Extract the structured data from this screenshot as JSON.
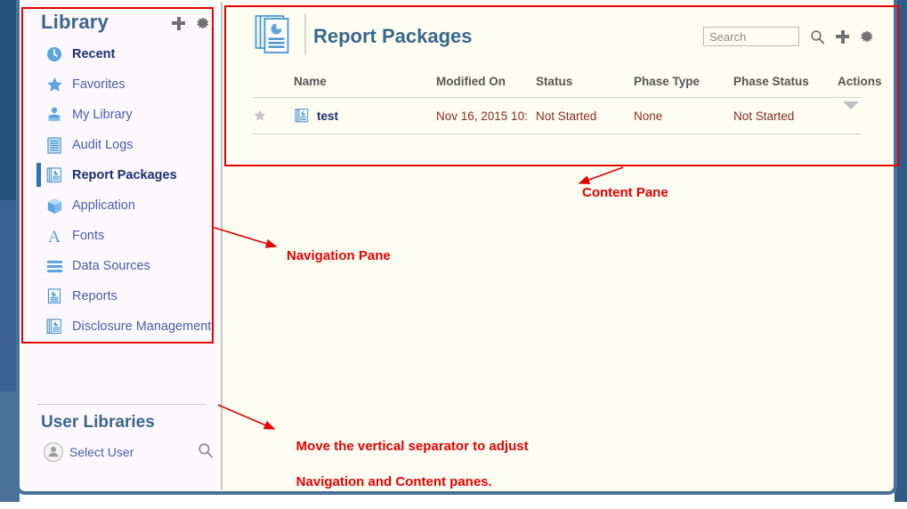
{
  "window": {
    "title": "Report Packages Library"
  },
  "navigation": {
    "title": "Library",
    "add_icon": "plus-icon",
    "settings_icon": "gear-icon",
    "items": [
      {
        "label": "Recent",
        "icon": "clock-icon",
        "selected": true,
        "active": false
      },
      {
        "label": "Favorites",
        "icon": "star-icon",
        "selected": false,
        "active": false
      },
      {
        "label": "My Library",
        "icon": "person-card-icon",
        "selected": false,
        "active": false
      },
      {
        "label": "Audit Logs",
        "icon": "lines-doc-icon",
        "selected": false,
        "active": false
      },
      {
        "label": "Report Packages",
        "icon": "report-stack-icon",
        "selected": false,
        "active": true
      },
      {
        "label": "Application",
        "icon": "cube-icon",
        "selected": false,
        "active": false
      },
      {
        "label": "Fonts",
        "icon": "letter-a-icon",
        "selected": false,
        "active": false
      },
      {
        "label": "Data Sources",
        "icon": "stack-bars-icon",
        "selected": false,
        "active": false
      },
      {
        "label": "Reports",
        "icon": "report-doc-icon",
        "selected": false,
        "active": false
      },
      {
        "label": "Disclosure Management",
        "icon": "report-stack-icon",
        "selected": false,
        "active": false
      }
    ],
    "user_libraries": {
      "title": "User Libraries",
      "select_user_label": "Select User",
      "user_icon": "user-avatar-icon",
      "search_icon": "search-icon"
    }
  },
  "content": {
    "title": "Report Packages",
    "title_icon": "report-stack-icon",
    "toolbar": {
      "search_placeholder": "Search",
      "search_value": "",
      "search_icon": "search-icon",
      "add_icon": "plus-icon",
      "settings_icon": "gear-icon"
    },
    "table": {
      "columns": [
        "Name",
        "Modified On",
        "Status",
        "Phase Type",
        "Phase Status",
        "Actions"
      ],
      "rows": [
        {
          "favorite_icon": "star-icon",
          "item_icon": "report-stack-icon",
          "name": "test",
          "modified_on": "Nov 16, 2015 10:",
          "status": "Not Started",
          "phase_type": "None",
          "phase_status": "Not Started",
          "actions_icon": "chevron-down-icon"
        }
      ]
    }
  },
  "annotations": {
    "content_pane": "Content Pane",
    "navigation_pane": "Navigation Pane",
    "separator_line1": "Move the vertical separator to adjust",
    "separator_line2": "Navigation and Content panes."
  },
  "colors": {
    "annotation": "#e60000",
    "accent_blue": "#39678f",
    "link_blue": "#4b5ea8",
    "icon_blue": "#63a2de",
    "value_red": "#8c2b24",
    "chrome_blue": "#3b6293",
    "panel_bg": "#fdfdf2",
    "nav_bg": "#fdf8fd"
  }
}
